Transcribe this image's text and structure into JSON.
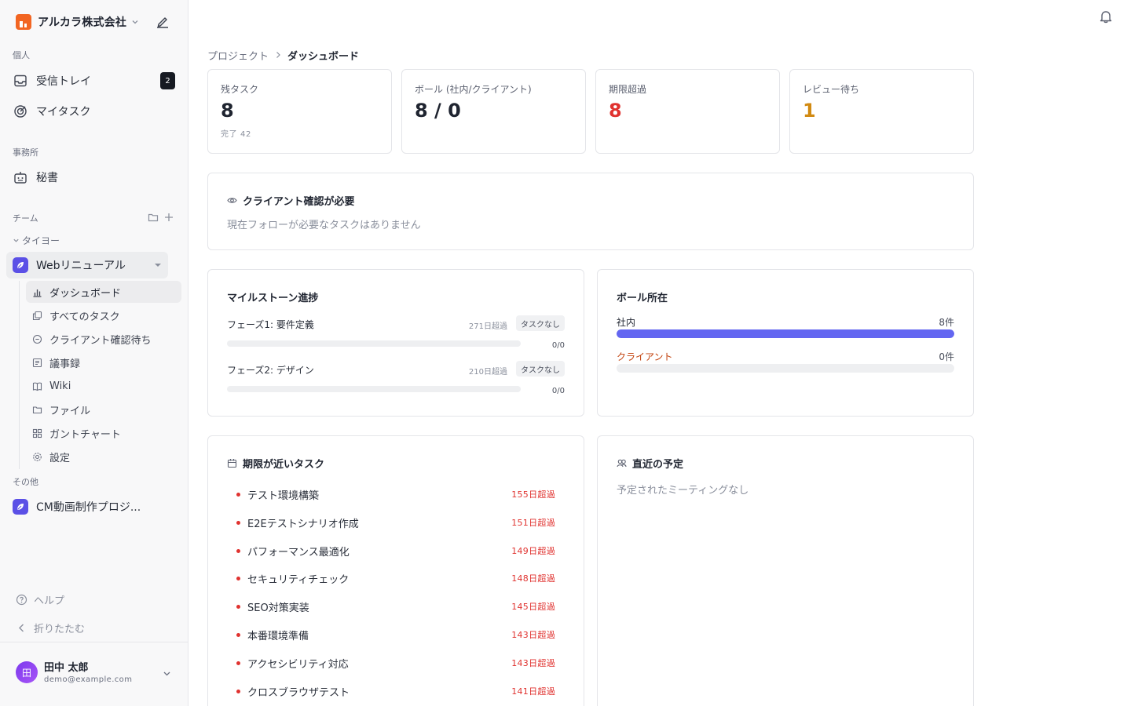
{
  "org": {
    "name": "アルカラ株式会社",
    "brand_color": "#f26522"
  },
  "sidebar": {
    "personal_label": "個人",
    "inbox": {
      "label": "受信トレイ",
      "badge": "2"
    },
    "my_tasks": {
      "label": "マイタスク"
    },
    "office_label": "事務所",
    "secretary": {
      "label": "秘書"
    },
    "team_label": "チーム",
    "group": "タイヨー",
    "project": {
      "name": "Webリニューアル",
      "color": "#5b50e6"
    },
    "subnav": [
      {
        "label": "ダッシュボード",
        "icon": "bar-chart-icon",
        "active": true
      },
      {
        "label": "すべてのタスク",
        "icon": "copy-icon"
      },
      {
        "label": "クライアント確認待ち",
        "icon": "message-icon"
      },
      {
        "label": "議事録",
        "icon": "document-icon"
      },
      {
        "label": "Wiki",
        "icon": "book-icon"
      },
      {
        "label": "ファイル",
        "icon": "folder-icon"
      },
      {
        "label": "ガントチャート",
        "icon": "grid-icon"
      },
      {
        "label": "設定",
        "icon": "gear-icon"
      }
    ],
    "other_label": "その他",
    "other_project": "CM動画制作プロジ...",
    "help": "ヘルプ",
    "collapse": "折りたたむ"
  },
  "user": {
    "name": "田中 太郎",
    "email": "demo@example.com",
    "initial": "田"
  },
  "breadcrumb": {
    "parent": "プロジェクト",
    "current": "ダッシュボード"
  },
  "stats": [
    {
      "label": "残タスク",
      "value": "8",
      "sub": "完了 42",
      "color": "#1f2430"
    },
    {
      "label": "ボール (社内/クライアント)",
      "value": "8 / 0",
      "sub": "",
      "color": "#1f2430"
    },
    {
      "label": "期限超過",
      "value": "8",
      "sub": "",
      "color": "#e0322f"
    },
    {
      "label": "レビュー待ち",
      "value": "1",
      "sub": "",
      "color": "#d18a12"
    }
  ],
  "client_review": {
    "title": "クライアント確認が必要",
    "empty": "現在フォローが必要なタスクはありません"
  },
  "milestones": {
    "title": "マイルストーン進捗",
    "items": [
      {
        "name": "フェーズ1: 要件定義",
        "overdue": "271日超過",
        "tag": "タスクなし",
        "count": "0/0",
        "progress": 0
      },
      {
        "name": "フェーズ2: デザイン",
        "overdue": "210日超過",
        "tag": "タスクなし",
        "count": "0/0",
        "progress": 0
      }
    ]
  },
  "ball": {
    "title": "ボール所在",
    "rows": [
      {
        "label": "社内",
        "count": "8件",
        "fraction": 1.0,
        "label_color": "#1f2430",
        "bar_color": "#6366f1"
      },
      {
        "label": "クライアント",
        "count": "0件",
        "fraction": 0.0,
        "label_color": "#c2410c",
        "bar_color": "#f59e0b"
      }
    ]
  },
  "upcoming": {
    "title": "期限が近いタスク",
    "tasks": [
      {
        "title": "テスト環境構築",
        "overdue": "155日超過"
      },
      {
        "title": "E2Eテストシナリオ作成",
        "overdue": "151日超過"
      },
      {
        "title": "パフォーマンス最適化",
        "overdue": "149日超過"
      },
      {
        "title": "セキュリティチェック",
        "overdue": "148日超過"
      },
      {
        "title": "SEO対策実装",
        "overdue": "145日超過"
      },
      {
        "title": "本番環境準備",
        "overdue": "143日超過"
      },
      {
        "title": "アクセシビリティ対応",
        "overdue": "143日超過"
      },
      {
        "title": "クロスブラウザテスト",
        "overdue": "141日超過"
      }
    ]
  },
  "schedule": {
    "title": "直近の予定",
    "empty": "予定されたミーティングなし"
  }
}
